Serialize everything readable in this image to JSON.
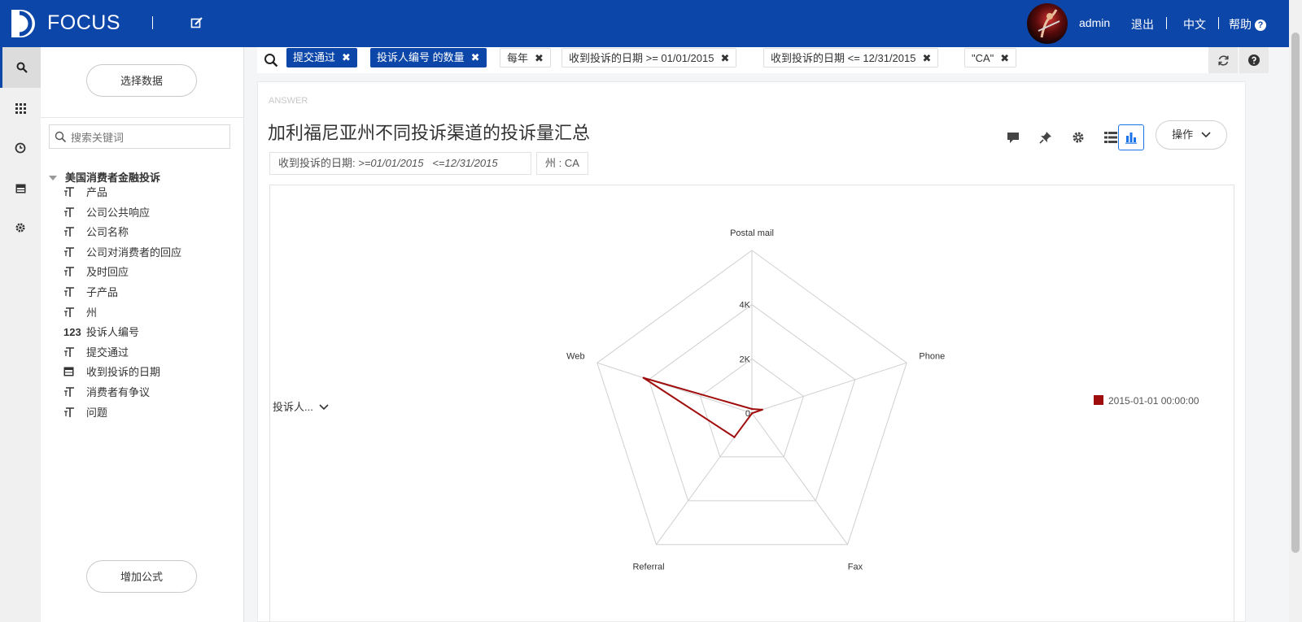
{
  "topbar": {
    "brand": "FOCUS",
    "user": "admin",
    "logout": "退出",
    "language": "中文",
    "help": "帮助",
    "help_icon_glyph": "?",
    "edit_icon": "edit-icon",
    "logo_icon": "focus-logo-icon"
  },
  "rail": {
    "items": [
      {
        "icon": "search-icon",
        "active": true
      },
      {
        "icon": "grid-icon",
        "active": false
      },
      {
        "icon": "clock-icon",
        "active": false
      },
      {
        "icon": "calendar-icon",
        "active": false
      },
      {
        "icon": "gear-icon",
        "active": false
      }
    ]
  },
  "panel": {
    "select_data_label": "选择数据",
    "search_placeholder": "搜索关键词",
    "dataset_name": "美国消费者金融投诉",
    "add_formula_label": "增加公式",
    "fields": [
      {
        "type": "T",
        "name": "产品"
      },
      {
        "type": "T",
        "name": "公司公共响应"
      },
      {
        "type": "T",
        "name": "公司名称"
      },
      {
        "type": "T",
        "name": "公司对消费者的回应"
      },
      {
        "type": "T",
        "name": "及时回应"
      },
      {
        "type": "T",
        "name": "子产品"
      },
      {
        "type": "T",
        "name": "州"
      },
      {
        "type": "123",
        "name": "投诉人编号"
      },
      {
        "type": "T",
        "name": "提交通过"
      },
      {
        "type": "cal",
        "name": "收到投诉的日期"
      },
      {
        "type": "T",
        "name": "消费者有争议"
      },
      {
        "type": "T",
        "name": "问题"
      }
    ]
  },
  "search_tokens": [
    {
      "label": "提交通过",
      "style": "blue"
    },
    {
      "label": "投诉人编号 的数量",
      "style": "blue"
    },
    {
      "label": "每年",
      "style": "gray"
    },
    {
      "label": "收到投诉的日期 >= 01/01/2015",
      "style": "gray"
    },
    {
      "label": "收到投诉的日期 <= 12/31/2015",
      "style": "gray"
    },
    {
      "label": "\"CA\"",
      "style": "gray"
    }
  ],
  "token_remove_glyph": "✖",
  "answer": {
    "label": "ANSWER",
    "title": "加利福尼亚州不同投诉渠道的投诉量汇总",
    "filters": {
      "date_label": "收到投诉的日期:",
      "date_value": ">=01/01/2015   <=12/31/2015",
      "state_label": "州 : CA"
    },
    "ops_label": "操作",
    "measure_select": "投诉人...",
    "actions": [
      "comment-icon",
      "pin-icon",
      "gear-icon",
      "table-view-icon",
      "chart-view-icon"
    ]
  },
  "chart_data": {
    "type": "radar",
    "axes": [
      "Postal mail",
      "Phone",
      "Fax",
      "Referral",
      "Web"
    ],
    "tick_labels": [
      "0",
      "2K",
      "4K"
    ],
    "range": [
      0,
      6000
    ],
    "grid": true,
    "legend_position": "right",
    "series": [
      {
        "name": "2015-01-01 00:00:00",
        "color": "#a00d0d",
        "values": [
          150,
          400,
          10,
          1100,
          4200
        ]
      }
    ]
  }
}
